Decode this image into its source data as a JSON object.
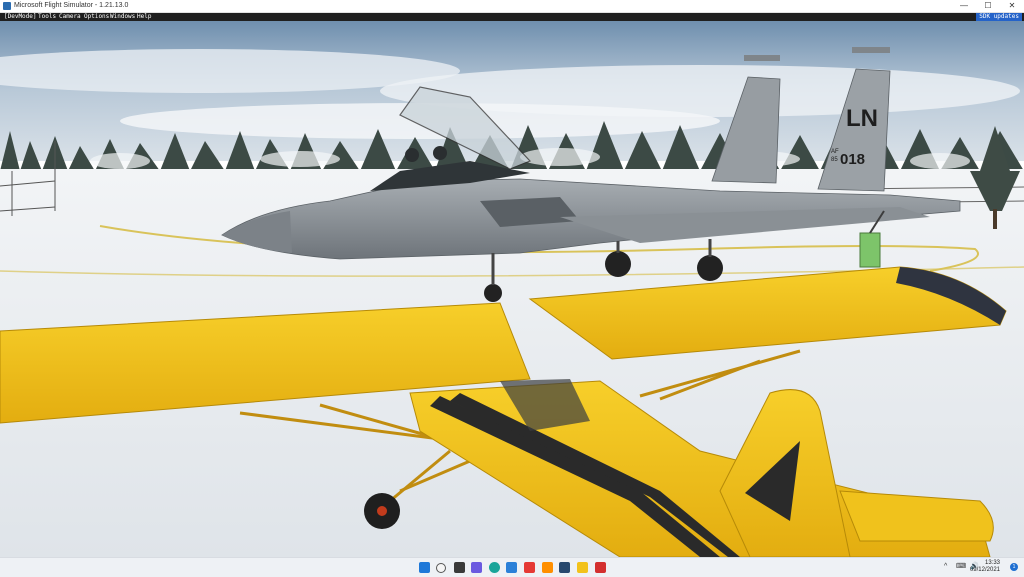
{
  "window": {
    "title": "Microsoft Flight Simulator - 1.21.13.0",
    "minimize_glyph": "—",
    "maximize_glyph": "☐",
    "close_glyph": "✕"
  },
  "menubar": {
    "items": [
      "[DevMode]",
      "Tools",
      "Camera",
      "Options",
      "Windows",
      "Help"
    ],
    "sdk_updates_label": "SDK updates"
  },
  "scene": {
    "jet_tail_code": "LN",
    "jet_tail_af": "AF",
    "jet_tail_year": "85",
    "jet_tail_serial": "018",
    "colors": {
      "sky": "#9fb7cc",
      "snow": "#eef1f4",
      "jet_gray": "#8c9298",
      "cub_yellow": "#f2c21b",
      "cub_stripe": "#2a2a2a",
      "taxi_line": "#d9c35a"
    }
  },
  "taskbar": {
    "icons": [
      "windows-start-icon",
      "search-icon",
      "task-view-icon",
      "chat-icon",
      "edge-icon",
      "store-icon",
      "file-explorer-icon",
      "mail-icon",
      "app-icon-red",
      "app-icon-orange",
      "app-icon-blue",
      "settings-icon",
      "photos-icon"
    ],
    "tray": [
      "^",
      "⌨",
      "🔊"
    ],
    "time": "13:33",
    "date": "09/12/2021",
    "notifications": "1"
  }
}
